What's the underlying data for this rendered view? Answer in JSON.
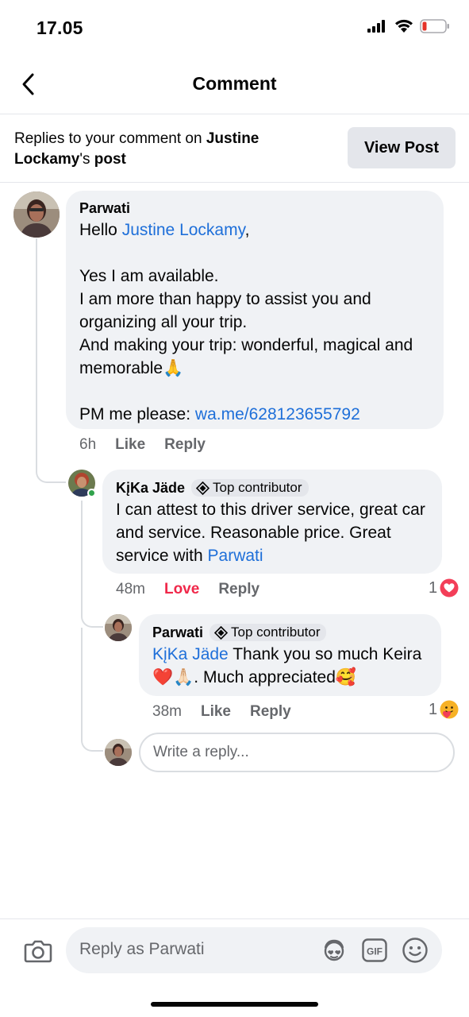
{
  "status_bar": {
    "time": "17.05"
  },
  "header": {
    "title": "Comment"
  },
  "context": {
    "prefix": "Replies to your comment on ",
    "post_owner": "Justine Lockamy",
    "suffix_possessive": "'s ",
    "suffix_bold": "post",
    "view_post_label": "View Post"
  },
  "comments": [
    {
      "author": "Parwati",
      "greeting": "Hello ",
      "mention": "Justine Lockamy",
      "greeting_end": ",",
      "line1": "Yes I am available.",
      "line2": "I am more than happy to assist you and organizing all your trip.",
      "line3": "And making your trip: wonderful, magical and memorable🙏",
      "pm_prefix": "PM me please: ",
      "pm_link": "wa.me/628123655792",
      "time": "6h",
      "like_label": "Like",
      "reply_label": "Reply"
    },
    {
      "author": "KįKa Jäde",
      "badge": "Top contributor",
      "text": "I can attest to this driver service, great car and service. Reasonable price. Great service with ",
      "mention": "Parwati",
      "time": "48m",
      "like_label": "Love",
      "reply_label": "Reply",
      "reaction_count": "1",
      "reaction_icon": "heart-reaction-icon"
    },
    {
      "author": "Parwati",
      "badge": "Top contributor",
      "mention": "KįKa Jäde",
      "text": " Thank you so much Keira ❤️🙏🏻. Much appreciated🥰",
      "time": "38m",
      "like_label": "Like",
      "reply_label": "Reply",
      "reaction_count": "1",
      "reaction_icon": "care-reaction-icon"
    }
  ],
  "write_reply": {
    "placeholder": "Write a reply..."
  },
  "composer": {
    "placeholder": "Reply as Parwati"
  }
}
